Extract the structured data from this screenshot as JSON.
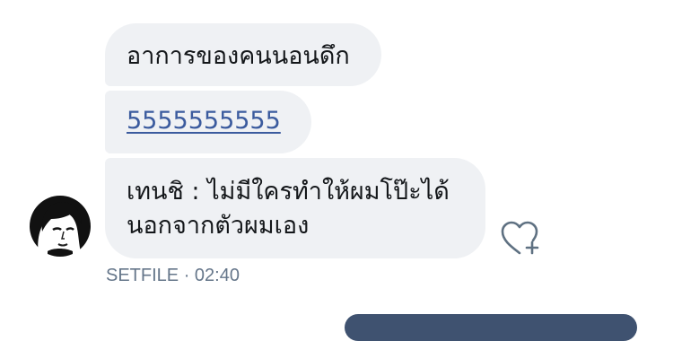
{
  "messages": [
    {
      "text": "อาการของคนนอนดึก"
    },
    {
      "link_text": "5555555555"
    },
    {
      "lines": [
        "เทนชิ : ไม่มีใครทำให้ผมโป๊ะได้",
        "นอกจากตัวผมเอง"
      ]
    }
  ],
  "meta": {
    "sender": "SETFILE",
    "separator": " · ",
    "time": "02:40"
  },
  "icons": {
    "avatar": "avatar-portrait",
    "like": "heart-plus-icon"
  },
  "colors": {
    "bubble": "#eff1f4",
    "text": "#14171a",
    "link": "#3b5b9e",
    "meta": "#65768a",
    "icon": "#5f7182",
    "button": "#3f5270"
  }
}
